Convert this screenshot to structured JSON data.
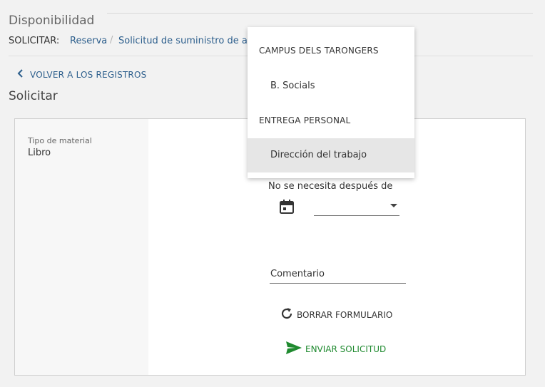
{
  "section": {
    "title": "Disponibilidad"
  },
  "request_bar": {
    "label": "SOLICITAR:",
    "links": [
      "Reserva",
      "Solicitud de suministro de artículos"
    ],
    "separator": "/"
  },
  "back_link": {
    "label": "VOLVER A LOS REGISTROS"
  },
  "page_title": "Solicitar",
  "card": {
    "material_type": {
      "label": "Tipo de material",
      "value": "Libro"
    },
    "need_by": {
      "label": "No se necesita después de",
      "selected_value": ""
    },
    "comment": {
      "placeholder": "Comentario"
    },
    "clear_button": "BORRAR FORMULARIO",
    "submit_button": "ENVIAR SOLICITUD"
  },
  "dropdown": {
    "groups": [
      {
        "label": "CAMPUS DELS TARONGERS",
        "items": [
          {
            "label": "B. Socials",
            "selected": false
          }
        ]
      },
      {
        "label": "ENTREGA PERSONAL",
        "items": [
          {
            "label": "Dirección del trabajo",
            "selected": true
          }
        ]
      }
    ]
  },
  "colors": {
    "link": "#2c5e8c",
    "submit": "#1f8a2f",
    "selected_bg": "#e6e6e6"
  },
  "icons": [
    "chevron-left-icon",
    "calendar-icon",
    "caret-down-icon",
    "refresh-icon",
    "send-icon"
  ]
}
